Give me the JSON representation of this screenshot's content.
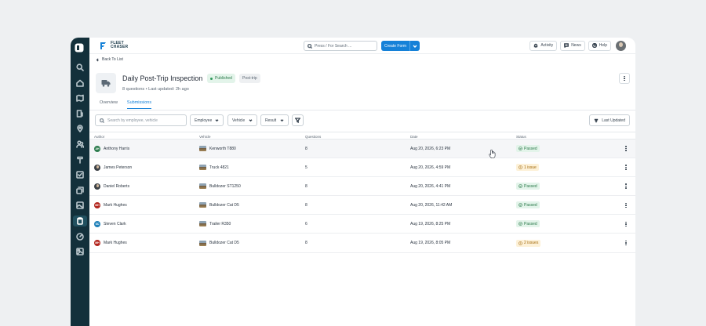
{
  "brand": {
    "logo_line1": "FLEET",
    "logo_line2": "CHASER"
  },
  "sidebar": {
    "items": [
      {
        "icon": "search-icon"
      },
      {
        "icon": "home-icon"
      },
      {
        "icon": "map-icon"
      },
      {
        "icon": "fuel-icon"
      },
      {
        "icon": "location-icon"
      },
      {
        "icon": "users-icon"
      },
      {
        "icon": "tools-icon"
      },
      {
        "icon": "checklist-icon"
      },
      {
        "icon": "layers-icon"
      },
      {
        "icon": "image-icon"
      },
      {
        "icon": "clipboard-icon"
      },
      {
        "icon": "gauge-icon"
      },
      {
        "icon": "photo-icon"
      }
    ]
  },
  "topbar": {
    "search_placeholder": "Press / For Search ...",
    "create_label": "Create Form",
    "activity_label": "Activity",
    "news_label": "News",
    "help_label": "Help"
  },
  "header": {
    "back_label": "Back To List",
    "title": "Daily Post-Trip Inspection",
    "status_badge": "Published",
    "tag": "Post-trip",
    "questions": "8 questions",
    "updated": "Last updated: 2h ago"
  },
  "tabs": [
    {
      "label": "Overview"
    },
    {
      "label": "Submissions"
    }
  ],
  "filters": {
    "search_placeholder": "Search by employee, vehicle",
    "employee": "Employee",
    "vehicle": "Vehicle",
    "result": "Result",
    "sort": "Last Updated"
  },
  "table": {
    "columns": {
      "author": "Author",
      "vehicle": "Vehicle",
      "questions": "Questions",
      "date": "Date",
      "status": "Status"
    },
    "rows": [
      {
        "author": "Anthony Harris",
        "initials": "AH",
        "avatar_color": "#2e7d4f",
        "vehicle": "Kenworth T880",
        "questions": "8",
        "date": "Aug 20, 2026, 6:23 PM",
        "status": "Passed",
        "kind": "passed"
      },
      {
        "author": "James Peterson",
        "initials": "",
        "avatar_color": "#3d4247",
        "vehicle": "Truck 4821",
        "questions": "5",
        "date": "Aug 20, 2026, 4:59 PM",
        "status": "1 issue",
        "kind": "issue"
      },
      {
        "author": "Daniel Roberts",
        "initials": "",
        "avatar_color": "#3d4247",
        "vehicle": "Bulldozer ST1250",
        "questions": "8",
        "date": "Aug 20, 2026, 4:41 PM",
        "status": "Passed",
        "kind": "passed"
      },
      {
        "author": "Mark Hughes",
        "initials": "MH",
        "avatar_color": "#b3261e",
        "vehicle": "Bulldozer Cat D5",
        "questions": "8",
        "date": "Aug 20, 2026, 11:42 AM",
        "status": "Passed",
        "kind": "passed"
      },
      {
        "author": "Steven Clark",
        "initials": "SC",
        "avatar_color": "#1e7fb8",
        "vehicle": "Trailer R350",
        "questions": "6",
        "date": "Aug 19, 2026, 8:25 PM",
        "status": "Passed",
        "kind": "passed"
      },
      {
        "author": "Mark Hughes",
        "initials": "MH",
        "avatar_color": "#b3261e",
        "vehicle": "Bulldozer Cat D5",
        "questions": "8",
        "date": "Aug 19, 2026, 8:05 PM",
        "status": "2 issues",
        "kind": "issue"
      }
    ]
  },
  "colors": {
    "accent": "#1581d8",
    "sidebar": "#13303b",
    "passed_bg": "#e3f4ea",
    "issue_bg": "#fdf1d8"
  }
}
